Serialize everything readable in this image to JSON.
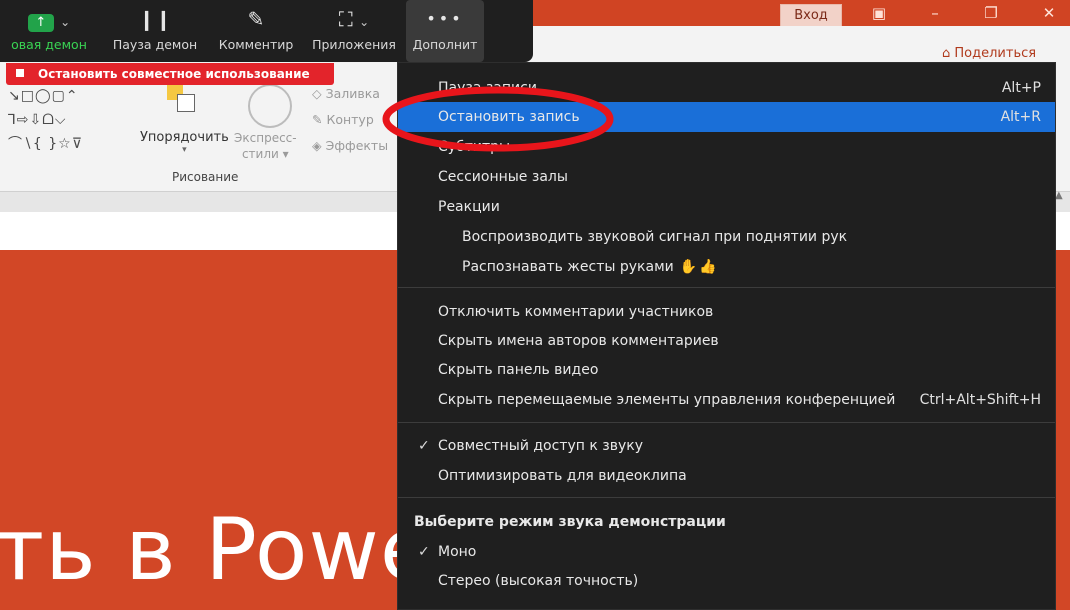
{
  "toolbar": {
    "items": [
      {
        "label": "овая демон",
        "icon": "share-up-arrow-icon"
      },
      {
        "label": "Пауза демон",
        "icon": "pause-icon"
      },
      {
        "label": "Комментир",
        "icon": "pencil-icon"
      },
      {
        "label": "Приложения",
        "icon": "apps-icon"
      },
      {
        "label": "Дополнит",
        "icon": "more-dots-icon"
      }
    ],
    "stop_share": "Остановить совместное использование"
  },
  "ppt": {
    "login": "Вход",
    "share": "Поделиться",
    "arrange": "Упорядочить",
    "express_styles_1": "Экспресс-",
    "express_styles_2": "стили",
    "fill": "Заливка",
    "outline": "Контур",
    "effects": "Эффекты",
    "drawing_group": "Рисование",
    "slide_text": "ть в PowerP"
  },
  "menu": {
    "items": [
      {
        "label": "Пауза записи",
        "shortcut": "Alt+P"
      },
      {
        "label": "Остановить запись",
        "shortcut": "Alt+R"
      },
      {
        "label": "Субтитры"
      },
      {
        "label": "Сессионные залы"
      },
      {
        "label": "Реакции"
      },
      {
        "label": "Воспроизводить звуковой сигнал при поднятии рук"
      },
      {
        "label": "Распознавать жесты руками"
      },
      {
        "label": "Отключить комментарии участников"
      },
      {
        "label": "Скрыть имена авторов комментариев"
      },
      {
        "label": "Скрыть панель видео"
      },
      {
        "label": "Скрыть перемещаемые элементы управления конференцией",
        "shortcut": "Ctrl+Alt+Shift+H"
      },
      {
        "label": "Совместный доступ к звуку",
        "checked": true
      },
      {
        "label": "Оптимизировать для видеоклипа"
      },
      {
        "label": "Выберите режим звука демонстрации"
      },
      {
        "label": "Моно",
        "checked": true
      },
      {
        "label": "Стерео (высокая точность)"
      }
    ],
    "check_mark": "✓"
  },
  "colors": {
    "ppt_orange": "#d24726",
    "menu_bg": "#1f1f1f",
    "selected": "#1a6fd8",
    "annotation": "#e8151b",
    "stop_share_red": "#e3242b"
  }
}
